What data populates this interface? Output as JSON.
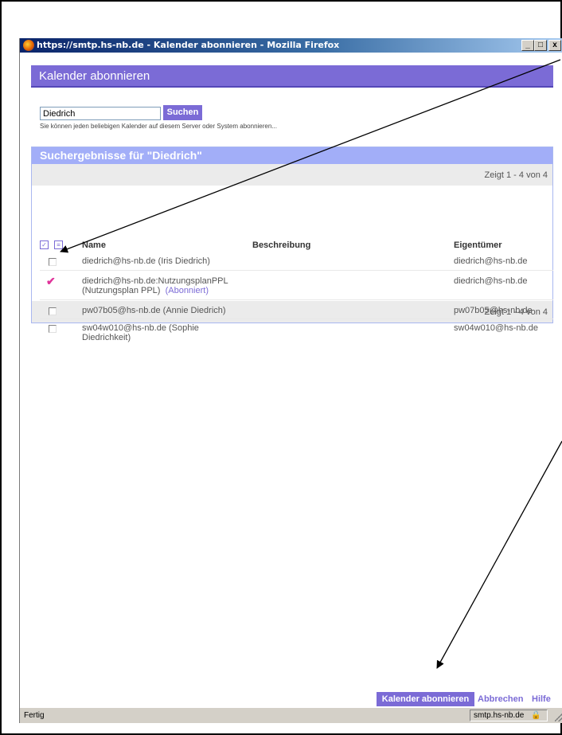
{
  "window": {
    "title": "https://smtp.hs-nb.de - Kalender abonnieren - Mozilla Firefox",
    "minimize": "_",
    "maximize": "□",
    "close": "x"
  },
  "header": {
    "title": "Kalender abonnieren"
  },
  "search": {
    "value": "Diedrich",
    "button": "Suchen",
    "hint": "Sie können jeden beliebigen Kalender auf diesem Server oder System abonnieren..."
  },
  "results": {
    "title": "Suchergebnisse für \"Diedrich\"",
    "pager_top": "Zeigt 1 - 4 von 4",
    "pager_bottom": "Zeigt 1 - 4 von 4",
    "columns": {
      "name": "Name",
      "description": "Beschreibung",
      "owner": "Eigentümer"
    },
    "rows": [
      {
        "name": "diedrich@hs-nb.de (Iris Diedrich)",
        "name2": "",
        "subscribed": "",
        "description": "",
        "owner": "diedrich@hs-nb.de",
        "checked": false
      },
      {
        "name": "diedrich@hs-nb.de:NutzungsplanPPL",
        "name2": "(Nutzungsplan PPL)",
        "subscribed": "(Abonniert)",
        "description": "",
        "owner": "diedrich@hs-nb.de",
        "checked": true
      },
      {
        "name": "pw07b05@hs-nb.de (Annie Diedrich)",
        "name2": "",
        "subscribed": "",
        "description": "",
        "owner": "pw07b05@hs-nb.de",
        "checked": false
      },
      {
        "name": "sw04w010@hs-nb.de (Sophie",
        "name2": "Diedrichkeit)",
        "subscribed": "",
        "description": "",
        "owner": "sw04w010@hs-nb.de",
        "checked": false
      }
    ]
  },
  "footer": {
    "subscribe": "Kalender abonnieren",
    "cancel": "Abbrechen",
    "help": "Hilfe"
  },
  "statusbar": {
    "status": "Fertig",
    "domain": "smtp.hs-nb.de"
  },
  "colors": {
    "accent": "#7b6bd6",
    "results_header": "#a2aef8",
    "check": "#e0339a"
  }
}
